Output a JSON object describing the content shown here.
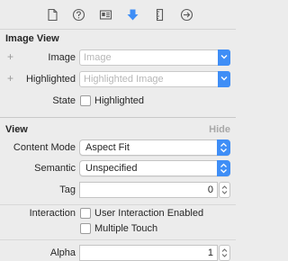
{
  "toolbar": {
    "icons": [
      "file-inspector-icon",
      "quick-help-icon",
      "identity-inspector-icon",
      "attributes-inspector-icon",
      "size-inspector-icon",
      "connections-inspector-icon"
    ],
    "accent_color": "#3f8ef6"
  },
  "image_view": {
    "title": "Image View",
    "image_label": "Image",
    "image_placeholder": "Image",
    "highlighted_label": "Highlighted",
    "highlighted_placeholder": "Highlighted Image",
    "state_label": "State",
    "state_checkbox_label": "Highlighted",
    "plus_symbol": "+"
  },
  "view": {
    "title": "View",
    "hide_label": "Hide",
    "content_mode_label": "Content Mode",
    "content_mode_value": "Aspect Fit",
    "semantic_label": "Semantic",
    "semantic_value": "Unspecified",
    "tag_label": "Tag",
    "tag_value": "0",
    "interaction_label": "Interaction",
    "user_interaction_label": "User Interaction Enabled",
    "multiple_touch_label": "Multiple Touch",
    "alpha_label": "Alpha",
    "alpha_value": "1"
  }
}
